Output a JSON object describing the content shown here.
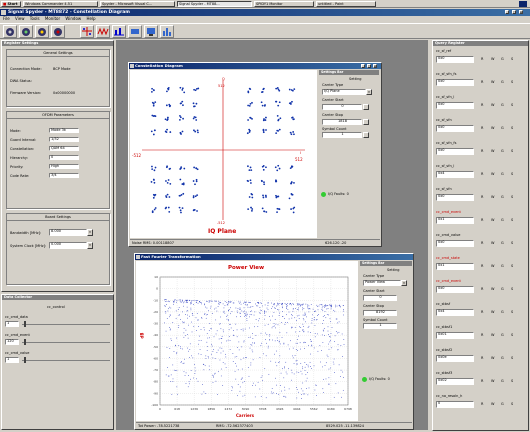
{
  "taskbar": {
    "start": "Start",
    "items": [
      "Windows Commander 4.51",
      "Spyder - Microsoft Visual C...",
      "Signal Spyder - MT88...",
      "SPIDY1 Monitor",
      "untitled - Paint"
    ]
  },
  "app": {
    "title": "Signal Spyder - MT8872 - Constellation Diagram",
    "menu": [
      "File",
      "View",
      "Tools",
      "Monitor",
      "Window",
      "Help"
    ]
  },
  "left": {
    "title": "Register Settings",
    "general": {
      "title": "General Settings",
      "rows": [
        {
          "label": "Connection Mode:",
          "value": "BCP Mode"
        },
        {
          "label": "DWA Status:",
          "value": ""
        },
        {
          "label": "Firmware Version:",
          "value": "0x00000000"
        }
      ]
    },
    "ofdm": {
      "title": "OFDM Parameters",
      "rows": [
        {
          "label": "Mode:",
          "value": "Mode 3k"
        },
        {
          "label": "Guard Interval:",
          "value": "1/32"
        },
        {
          "label": "Constellation:",
          "value": "QAM 64"
        },
        {
          "label": "Hierarchy:",
          "value": "0"
        },
        {
          "label": "Priority:",
          "value": "High"
        },
        {
          "label": "Code Rate:",
          "value": "3/4"
        }
      ]
    },
    "board": {
      "title": "Board Settings",
      "rows": [
        {
          "label": "Bandwidth [MHz]:",
          "value": "8.000"
        },
        {
          "label": "System Clock [MHz]:",
          "value": "0.000"
        }
      ]
    }
  },
  "collector": {
    "title": "Data Collector",
    "control": "cc_control",
    "rows": [
      {
        "label": "cc_cmd_data",
        "value": "1"
      },
      {
        "label": "cc_cmd_event",
        "value": "120"
      },
      {
        "label": "cc_cmd_value",
        "value": "1"
      }
    ]
  },
  "constellation": {
    "title": "Constellation Diagram",
    "q_label": "Q",
    "i_label": "I",
    "top": "512",
    "bottom": "-512",
    "left": "-512",
    "right": "512",
    "plane_label": "IQ Plane",
    "status_left": "Noise RMS: 0.00118807",
    "status_right": "626.120 -20",
    "settings": {
      "title": "Settings Bar",
      "heading": "Setting",
      "carrier_type_label": "Carrier Type",
      "carrier_type": "I/Q Plane",
      "carrier_start_label": "Carrier Start",
      "carrier_start": "0",
      "carrier_stop_label": "Carrier Stop",
      "carrier_stop": "1818",
      "symbol_count_label": "Symbol Count",
      "symbol_count": "1",
      "status": "I/Q Faults: 0"
    }
  },
  "fft": {
    "title": "Fast Fourier Transformation",
    "plot_title": "Power View",
    "ylabel": "dB",
    "xlabel": "Carriers",
    "yticks": [
      "10",
      "0",
      "-10",
      "-20",
      "-30",
      "-40",
      "-50",
      "-60",
      "-70",
      "-80",
      "-90",
      "-100"
    ],
    "xticks": [
      "0",
      "618",
      "1236",
      "1856",
      "2472",
      "3090",
      "3708",
      "4326",
      "4944",
      "5562",
      "6180",
      "6798"
    ],
    "status_left": "Tot Power: -78.5221738",
    "status_mid": "RMS: -72.562377403",
    "status_right": "8529.025 -11.139824",
    "settings": {
      "title": "Settings Bar",
      "heading": "Setting",
      "carrier_type_label": "Carrier Type",
      "carrier_type": "Power View",
      "carrier_start_label": "Carrier Start",
      "carrier_start": "0",
      "carrier_stop_label": "Carrier Stop",
      "carrier_stop": "8192",
      "symbol_count_label": "Symbol Count",
      "symbol_count": "1",
      "status": "I/Q Faults: 0"
    }
  },
  "query": {
    "title": "Query Register",
    "rows": [
      {
        "name": "cc_sf_ref",
        "value": "0x0",
        "red": false
      },
      {
        "name": "cc_sf_sfn_fs",
        "value": "0x0",
        "red": false
      },
      {
        "name": "cc_sf_sfn_l",
        "value": "0x0",
        "red": false
      },
      {
        "name": "cc_sf_sfn",
        "value": "0x0",
        "red": false
      },
      {
        "name": "cc_sf_sfn_fs",
        "value": "0x0",
        "red": false
      },
      {
        "name": "cc_sf_sfn_l",
        "value": "0x4",
        "red": false
      },
      {
        "name": "cc_sf_sfn",
        "value": "0x0",
        "red": false
      },
      {
        "name": "cc_cmd_event",
        "value": "0x1",
        "red": true
      },
      {
        "name": "cc_cmd_value",
        "value": "0x0",
        "red": false
      },
      {
        "name": "cc_cmd_state",
        "value": "0x1",
        "red": true
      },
      {
        "name": "cc_cmd_event",
        "value": "0x0",
        "red": true
      },
      {
        "name": "cc_stbsf",
        "value": "0x4",
        "red": false
      },
      {
        "name": "cc_stbsf1",
        "value": "0x01",
        "red": false
      },
      {
        "name": "cc_stbsf2",
        "value": "0x0e",
        "red": false
      },
      {
        "name": "cc_stbsf3",
        "value": "0x02",
        "red": false
      },
      {
        "name": "cc_no_resoln_h",
        "value": "0",
        "red": false
      }
    ],
    "flags": [
      "R",
      "W",
      "G",
      "S"
    ]
  }
}
